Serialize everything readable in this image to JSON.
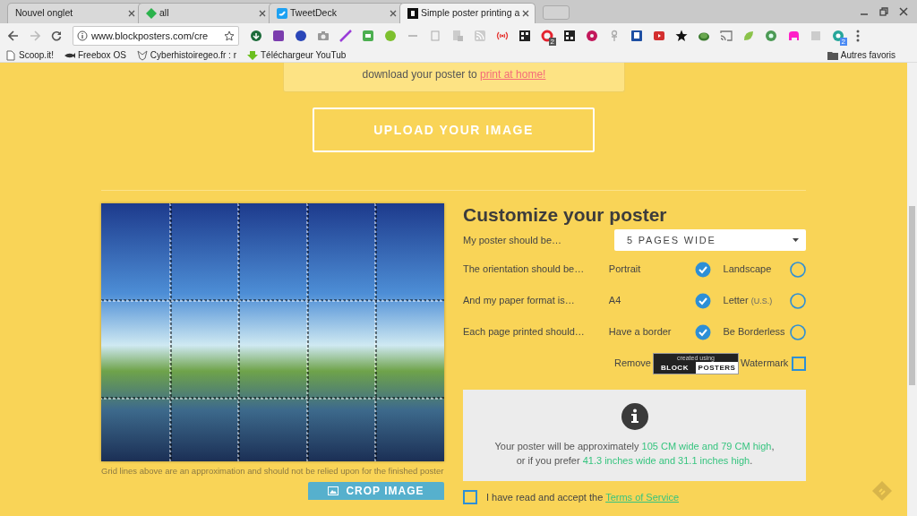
{
  "browser": {
    "tabs": [
      {
        "title": "Nouvel onglet",
        "selected": false
      },
      {
        "title": "all",
        "selected": false
      },
      {
        "title": "TweetDeck",
        "selected": false
      },
      {
        "title": "Simple poster printing a",
        "selected": true
      }
    ],
    "address": "www.blockposters.com/cre",
    "extension_badges": [
      "2",
      "2"
    ],
    "bookmarks": [
      "Scoop.it!",
      "Freebox OS",
      "Cyberhistoiregeo.fr : r",
      "Téléchargeur YouTub"
    ],
    "other_bookmarks": "Autres favoris"
  },
  "notice": {
    "text": "download your poster to ",
    "link": "print at home!"
  },
  "upload_button": "UPLOAD YOUR IMAGE",
  "preview": {
    "caption": "Grid lines above are an approximation and should not be relied upon for the finished poster",
    "crop_button": "CROP IMAGE"
  },
  "customize": {
    "title": "Customize your poster",
    "size_label": "My poster should be…",
    "size_value": "5 PAGES WIDE",
    "options": [
      {
        "label": "The orientation should be…",
        "choices": [
          {
            "text": "Portrait",
            "selected": true
          },
          {
            "text": "Landscape",
            "selected": false
          }
        ]
      },
      {
        "label": "And my paper format is…",
        "choices": [
          {
            "text": "A4",
            "selected": true
          },
          {
            "text": "Letter",
            "note": "(U.S.)",
            "selected": false
          }
        ]
      },
      {
        "label": "Each page printed should…",
        "choices": [
          {
            "text": "Have a border",
            "selected": true
          },
          {
            "text": "Be Borderless",
            "selected": false
          }
        ]
      }
    ],
    "watermark": {
      "prefix": "Remove",
      "logo_top": "created using",
      "logo_left": "BLOCK",
      "logo_right": "POSTERS",
      "label": "Watermark",
      "checked": false
    },
    "estimate": [
      [
        {
          "text": "Your poster will be approximately ",
          "highlight": false
        },
        {
          "text": "105 CM wide and 79 CM high",
          "highlight": true
        },
        {
          "text": ",",
          "highlight": false
        }
      ],
      [
        {
          "text": "or if you prefer ",
          "highlight": false
        },
        {
          "text": "41.3 inches wide and 31.1 inches high",
          "highlight": true
        },
        {
          "text": ".",
          "highlight": false
        }
      ]
    ],
    "terms": {
      "text": "I have read and accept the ",
      "link": "Terms of Service",
      "checked": false
    }
  }
}
